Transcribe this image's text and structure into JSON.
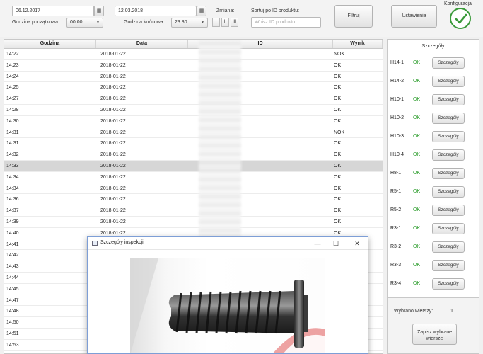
{
  "toolbar": {
    "date_from": "06.12.2017",
    "date_to": "12.03.2018",
    "calendar_glyph": "▦",
    "start_hour_label": "Godzina początkowa:",
    "start_hour_value": "00:00",
    "end_hour_label": "Godzina końcowa:",
    "end_hour_value": "23:30",
    "shift_label": "Zmiana:",
    "shifts": [
      "I",
      "II",
      "III"
    ],
    "sort_label": "Sortuj po ID produktu:",
    "sort_placeholder": "Wpisz ID produktu",
    "filter_button": "Filtruj",
    "settings_button": "Ustawienia",
    "config_label": "Konfiguracja"
  },
  "table": {
    "headers": [
      "Godzina",
      "Data",
      "ID",
      "Wynik"
    ],
    "rows": [
      {
        "time": "14:22",
        "date": "2018-01-22",
        "result": "NOK"
      },
      {
        "time": "14:23",
        "date": "2018-01-22",
        "result": "OK"
      },
      {
        "time": "14:24",
        "date": "2018-01-22",
        "result": "OK"
      },
      {
        "time": "14:25",
        "date": "2018-01-22",
        "result": "OK"
      },
      {
        "time": "14:27",
        "date": "2018-01-22",
        "result": "OK"
      },
      {
        "time": "14:28",
        "date": "2018-01-22",
        "result": "OK"
      },
      {
        "time": "14:30",
        "date": "2018-01-22",
        "result": "OK"
      },
      {
        "time": "14:31",
        "date": "2018-01-22",
        "result": "NOK"
      },
      {
        "time": "14:31",
        "date": "2018-01-22",
        "result": "OK"
      },
      {
        "time": "14:32",
        "date": "2018-01-22",
        "result": "OK"
      },
      {
        "time": "14:33",
        "date": "2018-01-22",
        "result": "OK"
      },
      {
        "time": "14:34",
        "date": "2018-01-22",
        "result": "OK"
      },
      {
        "time": "14:34",
        "date": "2018-01-22",
        "result": "OK"
      },
      {
        "time": "14:36",
        "date": "2018-01-22",
        "result": "OK"
      },
      {
        "time": "14:37",
        "date": "2018-01-22",
        "result": "OK"
      },
      {
        "time": "14:39",
        "date": "2018-01-22",
        "result": "OK"
      },
      {
        "time": "14:40",
        "date": "2018-01-22",
        "result": "OK"
      },
      {
        "time": "14:41",
        "date": "",
        "result": ""
      },
      {
        "time": "14:42",
        "date": "",
        "result": ""
      },
      {
        "time": "14:43",
        "date": "",
        "result": ""
      },
      {
        "time": "14:44",
        "date": "",
        "result": ""
      },
      {
        "time": "14:45",
        "date": "",
        "result": ""
      },
      {
        "time": "14:47",
        "date": "",
        "result": ""
      },
      {
        "time": "14:48",
        "date": "",
        "result": ""
      },
      {
        "time": "14:50",
        "date": "",
        "result": ""
      },
      {
        "time": "14:51",
        "date": "",
        "result": ""
      },
      {
        "time": "14:53",
        "date": "",
        "result": ""
      }
    ],
    "selected_index": 10
  },
  "details": {
    "title": "Szczegóły",
    "button_label": "Szczegóły",
    "items": [
      {
        "id": "H14-1",
        "status": "OK"
      },
      {
        "id": "H14-2",
        "status": "OK"
      },
      {
        "id": "H10-1",
        "status": "OK"
      },
      {
        "id": "H10-2",
        "status": "OK"
      },
      {
        "id": "H10-3",
        "status": "OK"
      },
      {
        "id": "H10-4",
        "status": "OK"
      },
      {
        "id": "H8-1",
        "status": "OK"
      },
      {
        "id": "R5-1",
        "status": "OK"
      },
      {
        "id": "R5-2",
        "status": "OK"
      },
      {
        "id": "R3-1",
        "status": "OK"
      },
      {
        "id": "R3-2",
        "status": "OK"
      },
      {
        "id": "R3-3",
        "status": "OK"
      },
      {
        "id": "R3-4",
        "status": "OK"
      }
    ],
    "status_color": "#2f9e2f"
  },
  "selection": {
    "label": "Wybrano wierszy:",
    "count": "1",
    "save_line1": "Zapisz wybrane",
    "save_line2": "wiersze"
  },
  "dialog": {
    "title": "Szczegóły inspekcji",
    "minimize": "—",
    "maximize": "☐",
    "close": "✕"
  },
  "colors": {
    "ok_green": "#2f9e2f",
    "selected_row": "#d6d6d6",
    "check_green": "#3a9a3a"
  }
}
